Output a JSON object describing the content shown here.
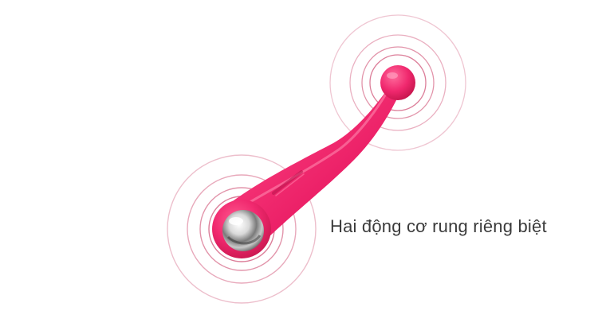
{
  "caption": "Hai động cơ rung riêng biệt",
  "colors": {
    "device_body": "#f0286e",
    "device_shadow": "#c9174f",
    "ring_stroke": "#d8708e",
    "steel_ball": "#c8c8c8",
    "caption_text": "#3b3b3b"
  },
  "figure": {
    "motors": [
      {
        "name": "large-end-motor",
        "vibration_rings": 4
      },
      {
        "name": "small-end-motor",
        "vibration_rings": 4
      }
    ],
    "ball": "steel-ball"
  }
}
